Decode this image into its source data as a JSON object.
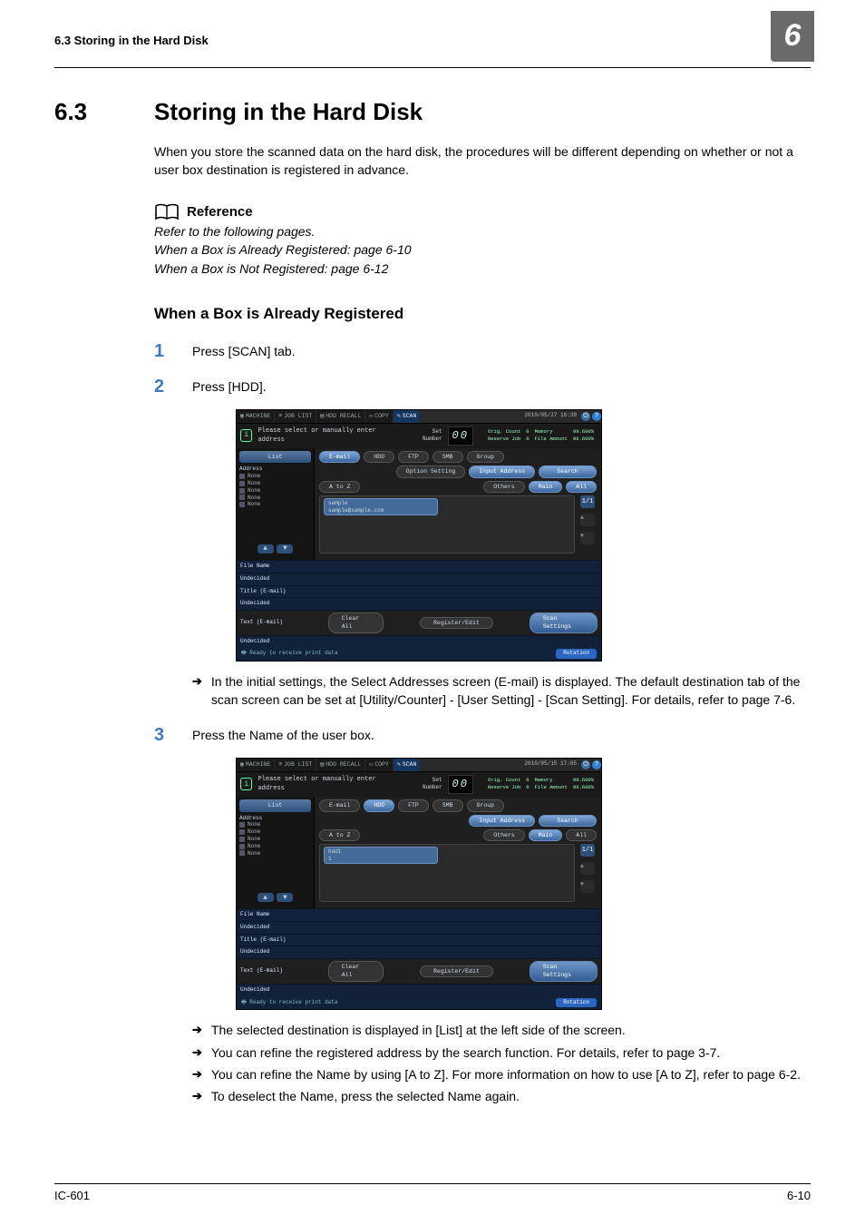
{
  "running_head": {
    "left": "6.3    Storing in the Hard Disk",
    "right_num": "6"
  },
  "section": {
    "num": "6.3",
    "title": "Storing in the Hard Disk"
  },
  "intro": "When you store the scanned data on the hard disk, the procedures  will be different depending on whether or not a user box destination is registered in advance.",
  "reference": {
    "heading": "Reference",
    "l1": "Refer to the following pages.",
    "l2": "When a Box is Already Registered: page 6-10",
    "l3": "When a Box is Not Registered: page 6-12"
  },
  "subheading": "When a Box is Already Registered",
  "steps": {
    "s1": "Press [SCAN] tab.",
    "s2": "Press [HDD].",
    "s2_notes": {
      "n1": "In the initial settings, the Select Addresses screen (E-mail) is displayed.  The default destination tab of the scan screen can be set at [Utility/Counter] - [User Setting] - [Scan Setting]. For details, refer to page 7-6."
    },
    "s3": "Press the Name of the user box.",
    "s3_notes": {
      "n1": "The selected destination is displayed in [List] at the left side of the screen.",
      "n2": "You can refine the registered address by the search function. For details, refer to page 3-7.",
      "n3": "You can refine the Name by using [A to Z]. For more information on how to use [A to Z], refer to page 6-2.",
      "n4": "To deselect the Name, press the selected Name again."
    }
  },
  "panel": {
    "tabs": {
      "machine": "MACHINE",
      "joblist": "JOB LIST",
      "hdd": "HDD RECALL",
      "copy": "COPY",
      "scan": "SCAN"
    },
    "clock1": "2010/05/27  16:39",
    "clock2": "2010/05/15  17:05",
    "topmsg": "Please select or manually enter address",
    "setnum_lbl": "Set Number",
    "setnum_val": "00",
    "stats_hdr": {
      "c1": "Orig. Count",
      "c2": "0",
      "c3": "Memory",
      "c4": "99.600%",
      "r2c1": "Reserve Job",
      "r2c2": "0",
      "r2c3": "File Amount",
      "r2c4": "96.600%"
    },
    "list": "List",
    "address_label": "Address",
    "none": "None",
    "dest_tabs": {
      "email": "E-mail",
      "hdd": "HDD",
      "ftp": "FTP",
      "smb": "SMB",
      "group": "Group"
    },
    "opt": "Option Setting",
    "input": "Input Address",
    "search": "Search",
    "az": "A to Z",
    "others": "Others",
    "main": "Main",
    "all": "All",
    "result1": {
      "name": "sample",
      "sub": "sample@sample.com"
    },
    "result2": {
      "name": "hdd1",
      "sub": "1"
    },
    "counter": "1/1",
    "filename": "File Name",
    "undecided": "Undecided",
    "titleemail": "Title (E-mail)",
    "textemail": "Text (E-mail)",
    "clear": "Clear All",
    "regedit": "Register/Edit",
    "scanset": "Scan Settings",
    "status": "Ready to receive print data",
    "rotation": "Rotation"
  },
  "footer": {
    "left": "IC-601",
    "right": "6-10"
  }
}
